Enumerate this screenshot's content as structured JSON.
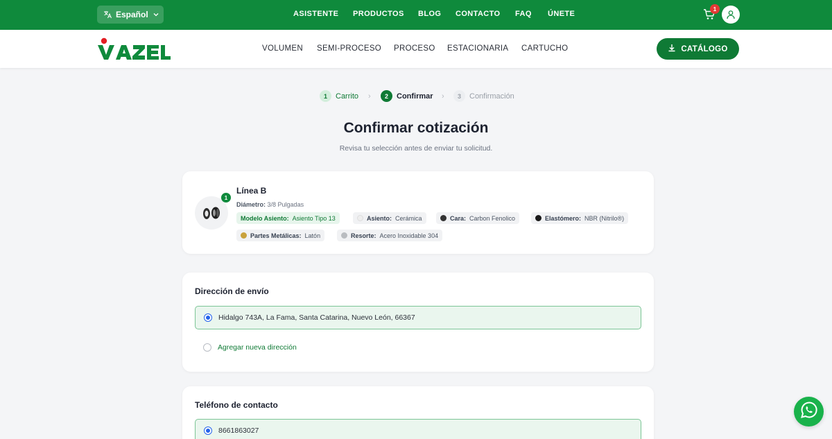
{
  "topbar": {
    "language": "Español",
    "nav": [
      "ASISTENTE",
      "PRODUCTOS",
      "BLOG",
      "CONTACTO",
      "FAQ",
      "ÚNETE"
    ],
    "cart_count": "1",
    "icons": [
      "translate-icon",
      "chevron-down-icon",
      "cart-icon",
      "user-icon"
    ]
  },
  "header": {
    "brand": "VAZEL",
    "nav": [
      "VOLUMEN",
      "SEMI-PROCESO",
      "PROCESO",
      "ESTACIONARIA",
      "CARTUCHO"
    ],
    "catalog_label": "CATÁLOGO"
  },
  "steps": [
    {
      "num": "1",
      "label": "Carrito",
      "state": "done"
    },
    {
      "num": "2",
      "label": "Confirmar",
      "state": "active"
    },
    {
      "num": "3",
      "label": "Confirmación",
      "state": "pending"
    }
  ],
  "page": {
    "title": "Confirmar cotización",
    "subtitle": "Revisa tu selección antes de enviar tu solicitud."
  },
  "product": {
    "quantity": "1",
    "name": "Línea B",
    "diameter_label": "Diámetro:",
    "diameter_value": "3/8 Pulgadas",
    "chips": [
      {
        "label": "Modelo Asiento:",
        "value": "Asiento Tipo 13",
        "color": ""
      },
      {
        "label": "Asiento:",
        "value": "Cerámica",
        "color": "#eeeeee"
      },
      {
        "label": "Cara:",
        "value": "Carbon Fenolico",
        "color": "#333333"
      },
      {
        "label": "Elastómero:",
        "value": "NBR (Nitrilo®)",
        "color": "#1a1a1a"
      },
      {
        "label": "Partes Metálicas:",
        "value": "Latón",
        "color": "#c9a23c"
      },
      {
        "label": "Resorte:",
        "value": "Acero Inoxidable 304",
        "color": "#b9bcc0"
      }
    ]
  },
  "shipping": {
    "title": "Dirección de envío",
    "selected_address": "Hidalgo 743A, La Fama, Santa Catarina, Nuevo León, 66367",
    "add_label": "Agregar nueva dirección"
  },
  "phone": {
    "title": "Teléfono de contacto",
    "selected_phone": "8661863027"
  },
  "colors": {
    "brand_green": "#0f8a3c",
    "brand_red": "#e31e24",
    "radio_blue": "#2563eb"
  }
}
